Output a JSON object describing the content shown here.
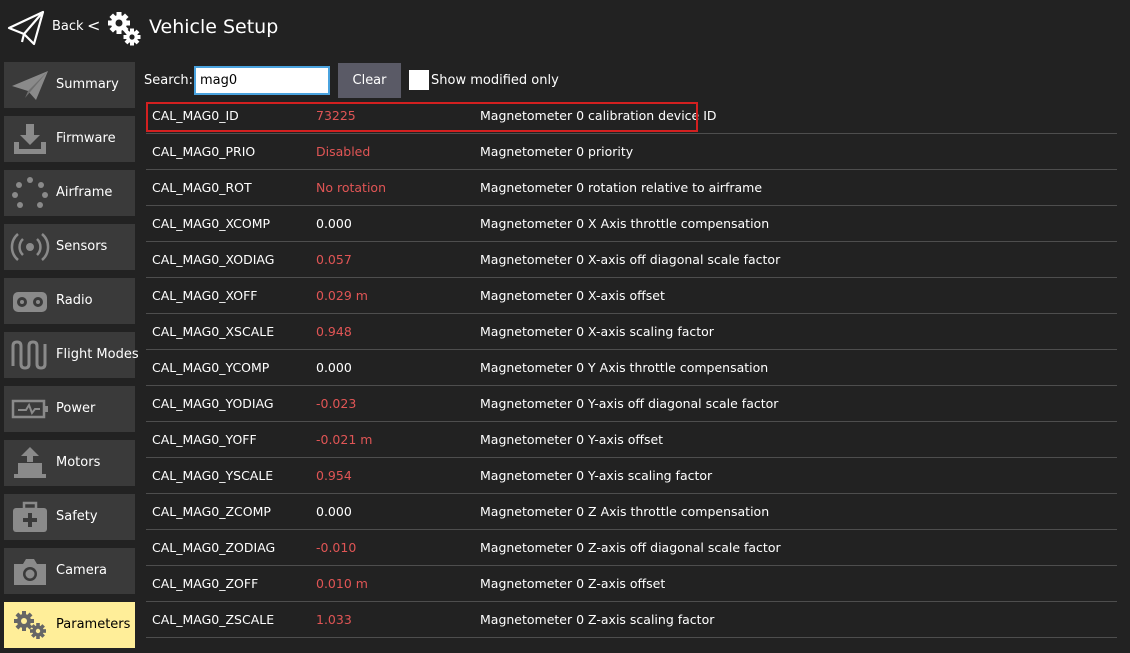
{
  "header": {
    "back_label": "Back",
    "chevron": "<",
    "title": "Vehicle Setup",
    "back_icon": "paper-plane-icon",
    "title_icon": "gears-icon"
  },
  "sidebar": {
    "items": [
      {
        "label": "Summary",
        "icon": "paper-plane-icon",
        "active": false
      },
      {
        "label": "Firmware",
        "icon": "download-icon",
        "active": false
      },
      {
        "label": "Airframe",
        "icon": "airframe-dots-icon",
        "active": false
      },
      {
        "label": "Sensors",
        "icon": "sensor-waves-icon",
        "active": false
      },
      {
        "label": "Radio",
        "icon": "radio-controller-icon",
        "active": false
      },
      {
        "label": "Flight Modes",
        "icon": "wave-icon",
        "active": false
      },
      {
        "label": "Power",
        "icon": "battery-icon",
        "active": false
      },
      {
        "label": "Motors",
        "icon": "motor-icon",
        "active": false
      },
      {
        "label": "Safety",
        "icon": "first-aid-icon",
        "active": false
      },
      {
        "label": "Camera",
        "icon": "camera-icon",
        "active": false
      },
      {
        "label": "Parameters",
        "icon": "gears-icon",
        "active": true
      }
    ]
  },
  "search": {
    "label": "Search:",
    "value": "mag0",
    "clear_label": "Clear",
    "show_modified_label": "Show modified only",
    "show_modified_checked": false
  },
  "colors": {
    "background": "#222222",
    "modified_value": "#e05555",
    "active_item": "#ffee99",
    "highlight": "#d32020"
  },
  "parameters": [
    {
      "name": "CAL_MAG0_ID",
      "value": "73225",
      "modified": true,
      "description": "Magnetometer 0 calibration device ID"
    },
    {
      "name": "CAL_MAG0_PRIO",
      "value": "Disabled",
      "modified": true,
      "description": "Magnetometer 0 priority"
    },
    {
      "name": "CAL_MAG0_ROT",
      "value": "No rotation",
      "modified": true,
      "description": "Magnetometer 0 rotation relative to airframe"
    },
    {
      "name": "CAL_MAG0_XCOMP",
      "value": "0.000",
      "modified": false,
      "description": "Magnetometer 0 X Axis throttle compensation"
    },
    {
      "name": "CAL_MAG0_XODIAG",
      "value": "0.057",
      "modified": true,
      "description": "Magnetometer 0 X-axis off diagonal scale factor"
    },
    {
      "name": "CAL_MAG0_XOFF",
      "value": "0.029 m",
      "modified": true,
      "description": "Magnetometer 0 X-axis offset"
    },
    {
      "name": "CAL_MAG0_XSCALE",
      "value": "0.948",
      "modified": true,
      "description": "Magnetometer 0 X-axis scaling factor"
    },
    {
      "name": "CAL_MAG0_YCOMP",
      "value": "0.000",
      "modified": false,
      "description": "Magnetometer 0 Y Axis throttle compensation"
    },
    {
      "name": "CAL_MAG0_YODIAG",
      "value": "-0.023",
      "modified": true,
      "description": "Magnetometer 0 Y-axis off diagonal scale factor"
    },
    {
      "name": "CAL_MAG0_YOFF",
      "value": "-0.021 m",
      "modified": true,
      "description": "Magnetometer 0 Y-axis offset"
    },
    {
      "name": "CAL_MAG0_YSCALE",
      "value": "0.954",
      "modified": true,
      "description": "Magnetometer 0 Y-axis scaling factor"
    },
    {
      "name": "CAL_MAG0_ZCOMP",
      "value": "0.000",
      "modified": false,
      "description": "Magnetometer 0 Z Axis throttle compensation"
    },
    {
      "name": "CAL_MAG0_ZODIAG",
      "value": "-0.010",
      "modified": true,
      "description": "Magnetometer 0 Z-axis off diagonal scale factor"
    },
    {
      "name": "CAL_MAG0_ZOFF",
      "value": "0.010 m",
      "modified": true,
      "description": "Magnetometer 0 Z-axis offset"
    },
    {
      "name": "CAL_MAG0_ZSCALE",
      "value": "1.033",
      "modified": true,
      "description": "Magnetometer 0 Z-axis scaling factor"
    }
  ]
}
